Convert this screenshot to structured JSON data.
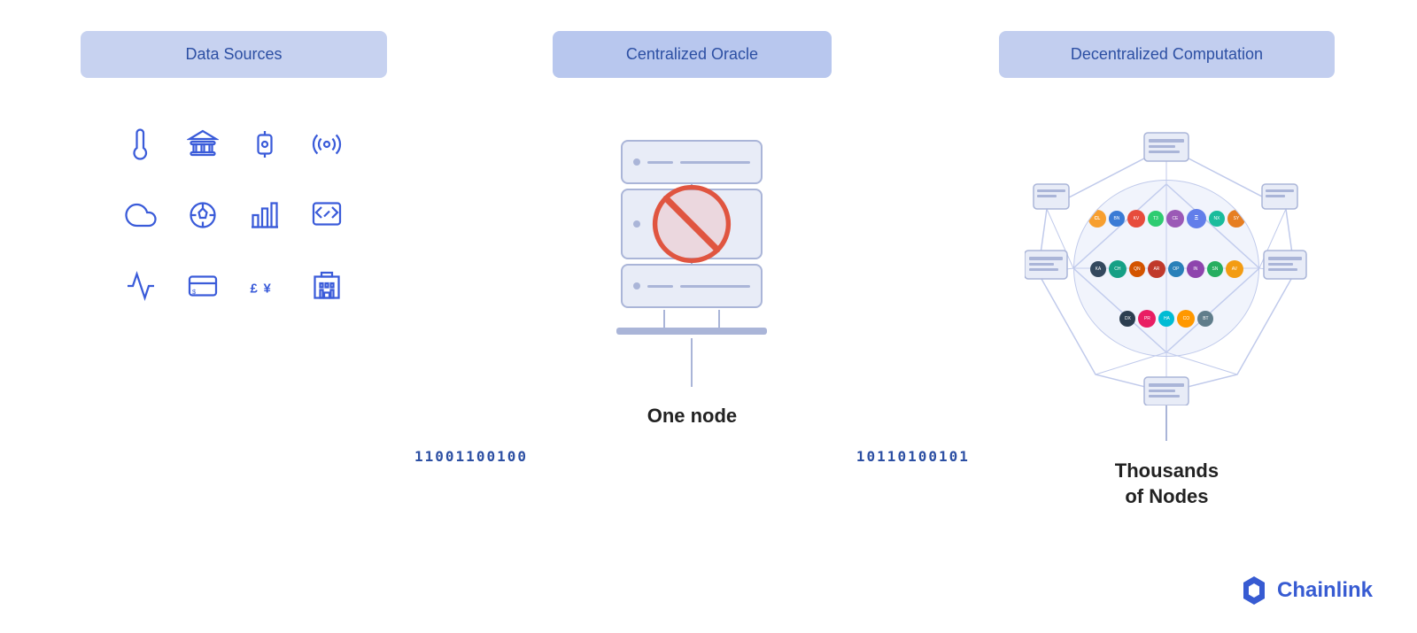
{
  "header": {
    "data_sources": "Data Sources",
    "centralized_oracle": "Centralized Oracle",
    "decentralized_computation": "Decentralized Computation"
  },
  "center": {
    "binary_left": "11001100100",
    "binary_right": "10110100101",
    "one_node": "One node",
    "thousands_of_nodes": "Thousands\nof Nodes"
  },
  "chainlink": {
    "name": "Chainlink"
  },
  "icons": [
    {
      "name": "thermometer-icon",
      "symbol": "🌡"
    },
    {
      "name": "bank-icon",
      "symbol": "🏦"
    },
    {
      "name": "smartwatch-icon",
      "symbol": "⌚"
    },
    {
      "name": "satellite-icon",
      "symbol": "📡"
    },
    {
      "name": "cloud-icon",
      "symbol": "☁"
    },
    {
      "name": "soccer-icon",
      "symbol": "⚽"
    },
    {
      "name": "chart-bar-icon",
      "symbol": "📊"
    },
    {
      "name": "code-icon",
      "symbol": "💻"
    },
    {
      "name": "graph-icon",
      "symbol": "📈"
    },
    {
      "name": "payment-icon",
      "symbol": "💳"
    },
    {
      "name": "currency-icon",
      "symbol": "💱"
    },
    {
      "name": "building-icon",
      "symbol": "🏢"
    }
  ],
  "logo_colors": [
    "#f79f2f",
    "#3a7bd5",
    "#e74c3c",
    "#2ecc71",
    "#9b59b6",
    "#1abc9c",
    "#e67e22",
    "#34495e",
    "#16a085",
    "#d35400",
    "#c0392b",
    "#2980b9",
    "#8e44ad",
    "#27ae60",
    "#f39c12",
    "#2c3e50",
    "#e91e63",
    "#00bcd4",
    "#ff9800",
    "#607d8b"
  ]
}
